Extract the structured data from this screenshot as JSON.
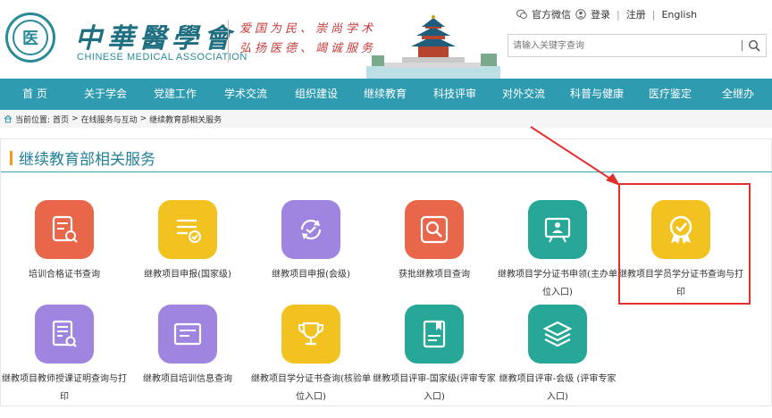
{
  "header": {
    "brand_cn": "中華醫學會",
    "brand_en": "CHINESE MEDICAL ASSOCIATION",
    "slogan_line1": "爱国为民、崇尚学术",
    "slogan_line2": "弘扬医德、竭诚服务",
    "seal_char": "医"
  },
  "topbar": {
    "wechat": "官方微信",
    "login": "登录",
    "register": "注册",
    "english": "English",
    "sep": "|"
  },
  "search": {
    "placeholder": "请输入关键字查询"
  },
  "nav": {
    "items": [
      "首 页",
      "关于学会",
      "党建工作",
      "学术交流",
      "组织建设",
      "继续教育",
      "科技评审",
      "对外交流",
      "科普与健康",
      "医疗鉴定",
      "全继办"
    ]
  },
  "breadcrumb": {
    "prefix": "当前位置:",
    "home": "首页",
    "gt1": ">",
    "level2": "在线服务与互动",
    "gt2": ">",
    "current": "继续教育部相关服务"
  },
  "panel": {
    "title": "继续教育部相关服务",
    "tiles": [
      {
        "label": "培训合格证书查询",
        "color": "#e8674a",
        "icon": "certificate-search-icon"
      },
      {
        "label": "继教项目申报(国家级)",
        "color": "#f2c320",
        "icon": "document-check-icon"
      },
      {
        "label": "继教项目申报(会级)",
        "color": "#9f85e0",
        "icon": "refresh-check-icon"
      },
      {
        "label": "获批继教项目查询",
        "color": "#e8674a",
        "icon": "magnifier-icon"
      },
      {
        "label": "继教项目学分证书申领(主办单位入口)",
        "color": "#27a797",
        "icon": "easel-person-icon"
      },
      {
        "label": "继教项目学员学分证书查询与打印",
        "color": "#f2c320",
        "icon": "badge-check-icon"
      },
      {
        "label": "继教项目教师授课证明查询与打印",
        "color": "#9f85e0",
        "icon": "list-search-icon"
      },
      {
        "label": "继教项目培训信息查询",
        "color": "#9f85e0",
        "icon": "card-message-icon"
      },
      {
        "label": "继教项目学分证书查询(核验单位入口)",
        "color": "#f2c320",
        "icon": "trophy-icon"
      },
      {
        "label": "继教项目评审-国家级(评审专家入口)",
        "color": "#27a797",
        "icon": "book-icon"
      },
      {
        "label": "继教项目评审-会级 (评审专家入口)",
        "color": "#27a797",
        "icon": "layers-icon"
      }
    ]
  },
  "colors": {
    "nav_bg": "#2f9bb0",
    "title_text": "#1f7f95",
    "accent_bar": "#f39a1e",
    "highlight": "#e23030"
  }
}
